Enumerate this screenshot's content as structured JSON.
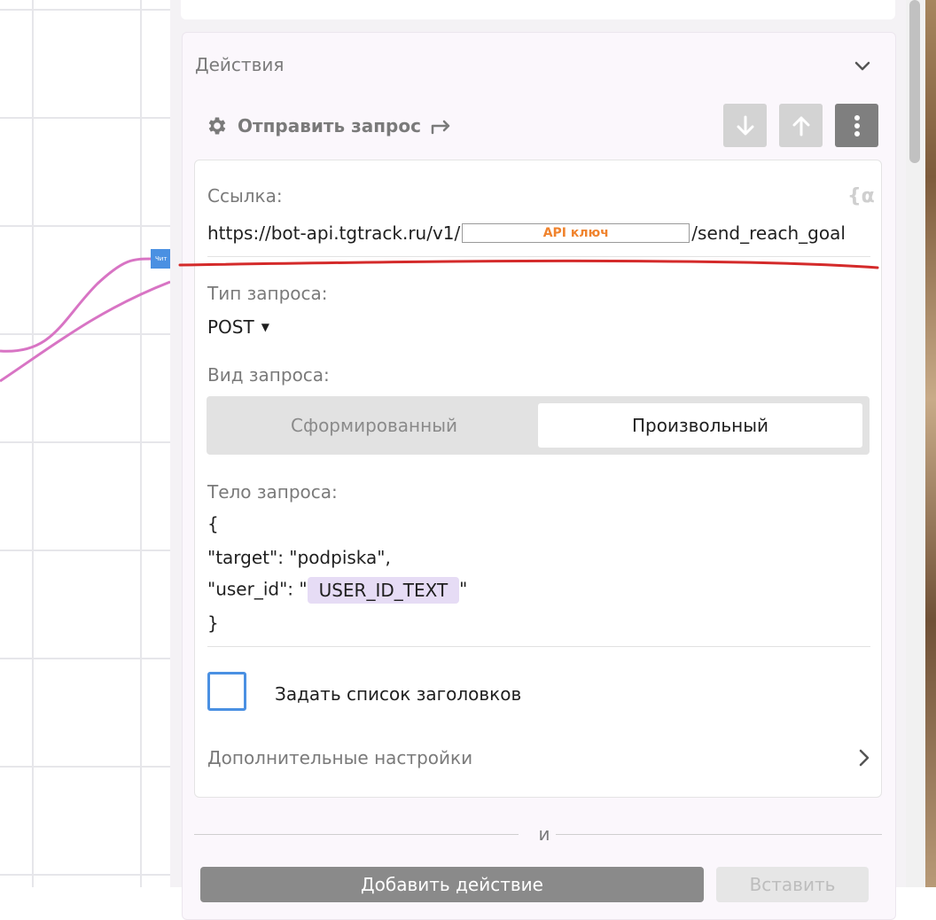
{
  "canvas": {
    "node_label": "Чит"
  },
  "actions": {
    "title": "Действия",
    "action_name": "Отправить запрос"
  },
  "request": {
    "url_label": "Ссылка:",
    "var_insert_icon": "{α",
    "url_prefix": "https://bot-api.tgtrack.ru/v1/",
    "api_key_placeholder": "API ключ",
    "url_suffix": "/send_reach_goal",
    "method_label": "Тип запроса:",
    "method_value": "POST",
    "kind_label": "Вид запроса:",
    "kind_options": [
      "Сформированный",
      "Произвольный"
    ],
    "kind_selected": "Произвольный",
    "body_label": "Тело запроса:",
    "body_lines": {
      "open": "{",
      "target": "\"target\": \"podpiska\",",
      "user_id_prefix": "\"user_id\": \"",
      "user_id_var": "USER_ID_TEXT",
      "user_id_suffix": "\"",
      "close": "}"
    },
    "headers_checkbox_label": "Задать список заголовков",
    "headers_checked": false,
    "more_settings": "Дополнительные настройки"
  },
  "separator_text": "и",
  "buttons": {
    "add_action": "Добавить действие",
    "paste": "Вставить"
  },
  "colors": {
    "accent_blue": "#4a90e2",
    "variable_chip": "#e6dcf5",
    "api_key_text": "#f0832d",
    "annotation_red": "#d42a2a",
    "connection_pink": "#d874c4"
  }
}
